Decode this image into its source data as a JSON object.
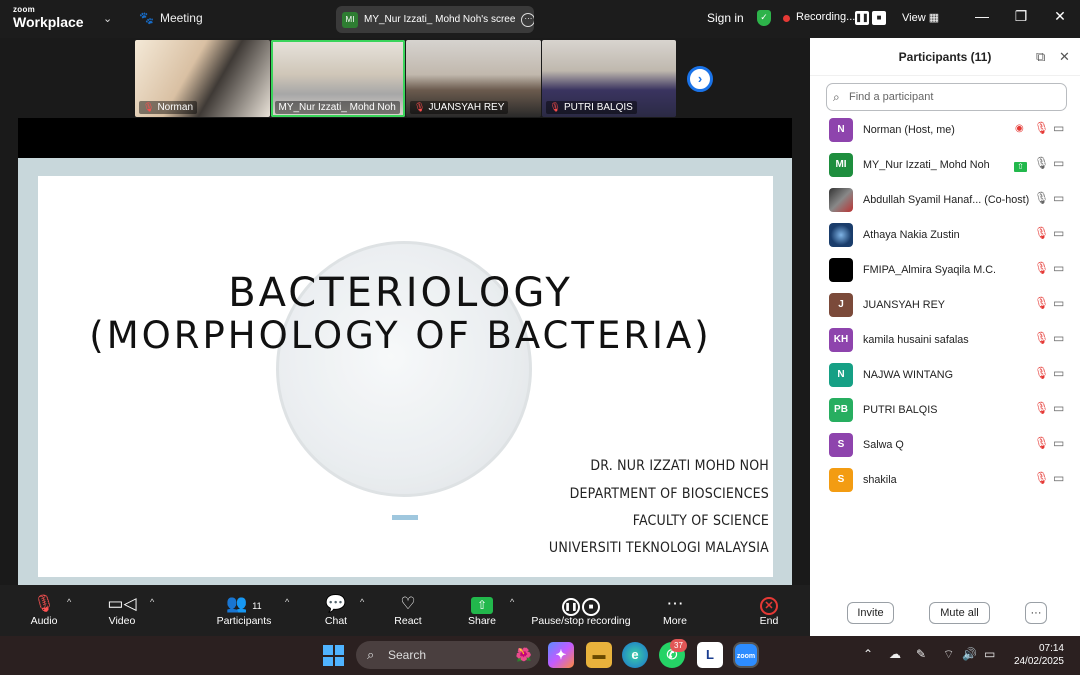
{
  "topbar": {
    "brand_small": "zoom",
    "brand_big": "Workplace",
    "meeting_label": "Meeting",
    "share_badge": "MI",
    "share_title": "MY_Nur Izzati_ Mohd Noh's scree",
    "sign_in": "Sign in",
    "recording_label": "Recording...",
    "view_label": "View"
  },
  "thumbnails": [
    {
      "name": "Norman",
      "muted": true
    },
    {
      "name": "MY_Nur Izzati_ Mohd Noh",
      "muted": false,
      "active": true
    },
    {
      "name": "JUANSYAH REY",
      "muted": true
    },
    {
      "name": "PUTRI BALQIS",
      "muted": true
    }
  ],
  "slide": {
    "title_line1": "BACTERIOLOGY",
    "title_line2": "(MORPHOLOGY OF BACTERIA)",
    "author_lines": [
      "DR. NUR IZZATI MOHD NOH",
      "DEPARTMENT OF BIOSCIENCES",
      "FACULTY OF SCIENCE",
      "UNIVERSITI TEKNOLOGI MALAYSIA"
    ]
  },
  "toolbar": {
    "audio": "Audio",
    "video": "Video",
    "participants": "Participants",
    "participants_count": "11",
    "chat": "Chat",
    "react": "React",
    "share": "Share",
    "pause_stop": "Pause/stop recording",
    "more": "More",
    "end": "End"
  },
  "panel": {
    "title": "Participants (11)",
    "search_placeholder": "Find a participant",
    "participants": [
      {
        "initials": "N",
        "name": "Norman (Host, me)",
        "color": "#8e44ad"
      },
      {
        "initials": "MI",
        "name": "MY_Nur Izzati_ Mohd Noh",
        "color": "#1e8e3e"
      },
      {
        "initials": "",
        "name": "Abdullah Syamil Hanaf... (Co-host)",
        "color": "#555555"
      },
      {
        "initials": "",
        "name": "Athaya Nakia Zustin",
        "color": "#1a3d6b"
      },
      {
        "initials": "",
        "name": "FMIPA_Almira Syaqila M.C.",
        "color": "#000000"
      },
      {
        "initials": "J",
        "name": "JUANSYAH REY",
        "color": "#7b4a3a"
      },
      {
        "initials": "KH",
        "name": "kamila husaini safalas",
        "color": "#8e44ad"
      },
      {
        "initials": "N",
        "name": "NAJWA WINTANG",
        "color": "#16a085"
      },
      {
        "initials": "PB",
        "name": "PUTRI BALQIS",
        "color": "#27ae60"
      },
      {
        "initials": "S",
        "name": "Salwa Q",
        "color": "#8e44ad"
      },
      {
        "initials": "S",
        "name": "shakila",
        "color": "#f39c12"
      }
    ],
    "invite": "Invite",
    "mute_all": "Mute all"
  },
  "taskbar": {
    "search": "Search",
    "whatsapp_badge": "37",
    "time": "07:14",
    "date": "24/02/2025"
  },
  "colors": {
    "accent_green": "#22b84c",
    "record_red": "#e53935",
    "zoom_blue": "#1a73e8"
  }
}
